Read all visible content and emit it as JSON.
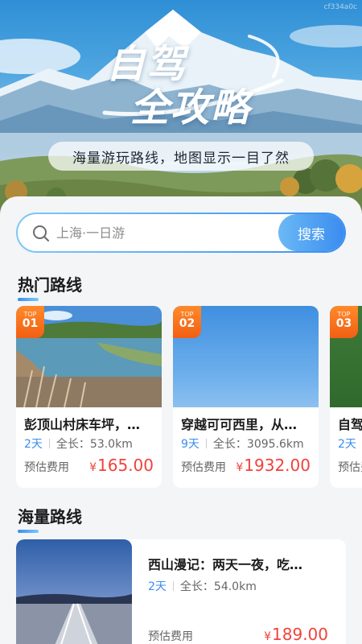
{
  "hero": {
    "code": "cf334a0c",
    "title_line1": "自驾",
    "title_line2": "全攻略",
    "subtitle": "海量游玩路线，地图显示一目了然"
  },
  "search": {
    "placeholder": "上海·一日游",
    "button_label": "搜索"
  },
  "hot_section": {
    "title": "热门路线",
    "routes": [
      {
        "badge_top": "TOP",
        "badge_rank": "01",
        "name": "彭顶山村床车坪，…",
        "days": "2天",
        "length": "全长：53.0km",
        "cost_label": "预估费用",
        "price_symbol": "¥",
        "price": "165.00"
      },
      {
        "badge_top": "TOP",
        "badge_rank": "02",
        "name": "穿越可可西里，从…",
        "days": "9天",
        "length": "全长：3095.6km",
        "cost_label": "预估费用",
        "price_symbol": "¥",
        "price": "1932.00"
      },
      {
        "badge_top": "TOP",
        "badge_rank": "03",
        "name": "自驾…",
        "days": "2天",
        "length": "",
        "cost_label": "预估费用",
        "price_symbol": "",
        "price": ""
      }
    ]
  },
  "mass_section": {
    "title": "海量路线",
    "routes": [
      {
        "name": "西山漫记：两天一夜，吃…",
        "days": "2天",
        "length": "全长：54.0km",
        "cost_label": "预估费用",
        "price_symbol": "¥",
        "price": "189.00"
      }
    ]
  },
  "colors": {
    "accent_blue": "#3a8cef",
    "price_red": "#f0433a",
    "badge_orange": "#f25f14"
  }
}
